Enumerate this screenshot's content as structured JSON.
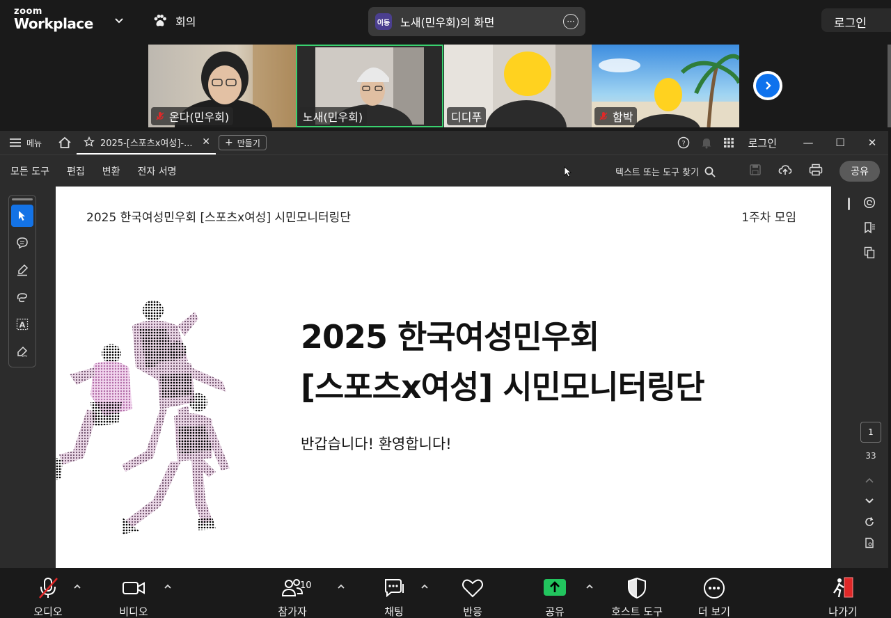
{
  "zoom": {
    "logo_line1": "zoom",
    "logo_line2": "Workplace",
    "meeting_label": "회의",
    "share_app_badge": "이동",
    "share_title": "노새(민우회)의 화면",
    "login": "로그인"
  },
  "participants": [
    {
      "name": "온다(민우회)",
      "muted": true
    },
    {
      "name": "노새(민우회)",
      "muted": false
    },
    {
      "name": "디디푸",
      "muted": false
    },
    {
      "name": "함박",
      "muted": true
    }
  ],
  "acrobat": {
    "menu_label": "메뉴",
    "tab_title": "2025-[스포츠x여성]-...",
    "create_label": "만들기",
    "login": "로그인",
    "tools": [
      "모든 도구",
      "편집",
      "변환",
      "전자 서명"
    ],
    "search_placeholder": "텍스트 또는 도구 찾기",
    "share_label": "공유",
    "page_current": "1",
    "page_total": "33"
  },
  "slide": {
    "header_left": "2025 한국여성민우회 [스포츠x여성] 시민모니터링단",
    "header_right": "1주차 모임",
    "title_line1": "2025 한국여성민우회",
    "title_line2": "[스포츠x여성] 시민모니터링단",
    "subtitle": "반갑습니다! 환영합니다!"
  },
  "toolbar": {
    "audio": "오디오",
    "video": "비디오",
    "participants": "참가자",
    "participants_count": "10",
    "chat": "채팅",
    "reactions": "반응",
    "share": "공유",
    "host_tools": "호스트 도구",
    "more": "더 보기",
    "leave": "나가기"
  },
  "colors": {
    "share_green": "#22c55e",
    "active_tile": "#3ad16f",
    "acrobat_blue": "#1473e6",
    "mute_red": "#e02828"
  }
}
